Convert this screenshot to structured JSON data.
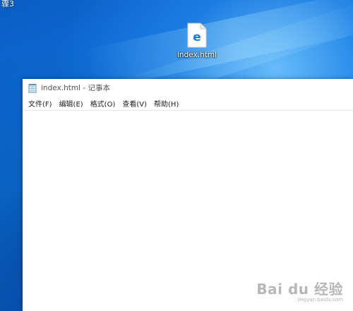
{
  "desktop": {
    "corner_text": "骤3",
    "file": {
      "name": "index.html",
      "icon": "edge-file-icon"
    }
  },
  "notepad": {
    "title": "index.html - 记事本",
    "menu": [
      {
        "label": "文件(F)"
      },
      {
        "label": "编辑(E)"
      },
      {
        "label": "格式(O)"
      },
      {
        "label": "查看(V)"
      },
      {
        "label": "帮助(H)"
      }
    ],
    "content": ""
  },
  "watermark": {
    "main": "Bai du 经验",
    "sub": "jingyan.baidu.com"
  },
  "colors": {
    "edge_blue": "#1f79d1",
    "desktop_blue": "#0a63c9"
  }
}
